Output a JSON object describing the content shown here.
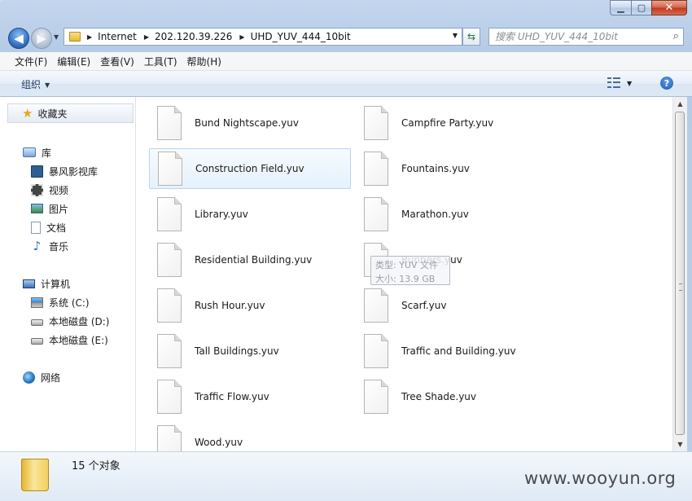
{
  "address": {
    "crumbs": [
      "Internet",
      "202.120.39.226",
      "UHD_YUV_444_10bit"
    ]
  },
  "search": {
    "placeholder": "搜索 UHD_YUV_444_10bit"
  },
  "menu": [
    "文件(F)",
    "编辑(E)",
    "查看(V)",
    "工具(T)",
    "帮助(H)"
  ],
  "toolbar": {
    "organize_label": "组织",
    "help_label": "?"
  },
  "sidebar": {
    "favorites": "收藏夹",
    "libraries": {
      "label": "库",
      "items": [
        "暴风影视库",
        "视频",
        "图片",
        "文档",
        "音乐"
      ]
    },
    "computer": {
      "label": "计算机",
      "items": [
        "系统 (C:)",
        "本地磁盘 (D:)",
        "本地磁盘 (E:)"
      ]
    },
    "network": "网络"
  },
  "files": [
    {
      "name": "Bund Nightscape.yuv"
    },
    {
      "name": "Campfire Party.yuv"
    },
    {
      "name": "Construction Field.yuv",
      "selected": true
    },
    {
      "name": "Fountains.yuv"
    },
    {
      "name": "Library.yuv"
    },
    {
      "name": "Marathon.yuv"
    },
    {
      "name": "Residential Building.yuv"
    },
    {
      "name": "Runners.yuv"
    },
    {
      "name": "Rush Hour.yuv"
    },
    {
      "name": "Scarf.yuv"
    },
    {
      "name": "Tall Buildings.yuv"
    },
    {
      "name": "Traffic and Building.yuv"
    },
    {
      "name": "Traffic Flow.yuv"
    },
    {
      "name": "Tree Shade.yuv"
    },
    {
      "name": "Wood.yuv"
    }
  ],
  "tooltip": {
    "type_line": "类型: YUV 文件",
    "size_line": "大小: 13.9 GB"
  },
  "status": {
    "count": "15 个对象"
  },
  "watermark": "www.wooyun.org"
}
